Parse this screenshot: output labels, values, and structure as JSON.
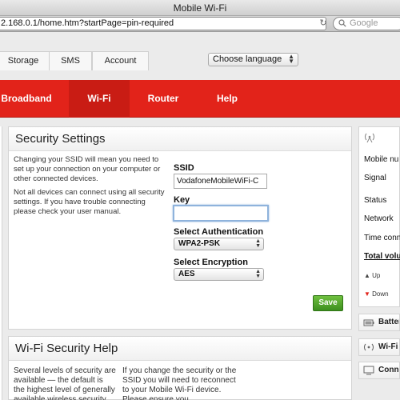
{
  "window": {
    "title": "Mobile Wi-Fi"
  },
  "browser": {
    "url": "2.168.0.1/home.htm?startPage=pin-required",
    "search_placeholder": "Google"
  },
  "top_tabs": [
    "Storage",
    "SMS",
    "Account"
  ],
  "language": {
    "selected": "Choose language"
  },
  "main_nav": [
    {
      "label": "Broadband"
    },
    {
      "label": "Wi-Fi"
    },
    {
      "label": "Router"
    },
    {
      "label": "Help"
    }
  ],
  "security_settings": {
    "title": "Security Settings",
    "help_p1": "Changing your SSID will mean you need to set up your connection on your computer or other connected devices.",
    "help_p2": "Not all devices can connect using all security settings. If you have trouble connecting please check your user manual.",
    "ssid_label": "SSID",
    "ssid_value": "VodafoneMobileWiFi-C",
    "key_label": "Key",
    "key_value": "",
    "auth_label": "Select Authentication",
    "auth_value": "WPA2-PSK",
    "enc_label": "Select Encryption",
    "enc_value": "AES",
    "save_label": "Save"
  },
  "wifi_security_help": {
    "title": "Wi-Fi Security Help",
    "col1": "Several levels of security are available — the default is the highest level of generally available wireless security",
    "col2": "If you change the security or the SSID you will need to reconnect to your Mobile Wi-Fi device. Please ensure you"
  },
  "sidebar": {
    "status_items": [
      "Mobile nu",
      "Signal",
      "Status",
      "Network",
      "Time conn"
    ],
    "total_volume": "Total volu",
    "legend_up": "Up",
    "legend_down": "Down",
    "battery": "Batter",
    "wifi": "Wi-Fi S",
    "connected": "Conne"
  },
  "colors": {
    "brand_red": "#e2231a",
    "save_green": "#4aa329"
  }
}
